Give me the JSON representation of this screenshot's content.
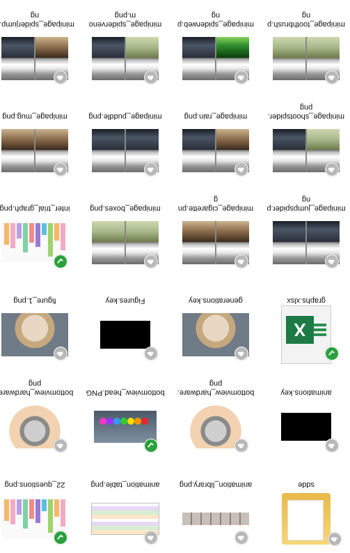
{
  "files": [
    {
      "name": "sdde",
      "type": "folder",
      "badge": "grey"
    },
    {
      "name": "animation_library.png",
      "type": "strip",
      "badge": "grey"
    },
    {
      "name": "animation_table.png",
      "type": "table",
      "badge": "grey"
    },
    {
      "name": "22_questions.png",
      "type": "bars",
      "badge": "green"
    },
    {
      "name": "animations.key",
      "type": "black",
      "badge": "grey"
    },
    {
      "name": "bottomview_hardware.png",
      "type": "hand",
      "badge": "grey"
    },
    {
      "name": "bottomview_head.PNG",
      "type": "blob",
      "badge": "green"
    },
    {
      "name": "bottomview_hardware.png",
      "type": "hand",
      "badge": "grey"
    },
    {
      "name": "graphs.xlsx",
      "type": "xlsx",
      "badge": "green"
    },
    {
      "name": "generations.key",
      "type": "dome",
      "badge": "grey"
    },
    {
      "name": "Figures.key",
      "type": "black",
      "badge": "grey"
    },
    {
      "name": "figure_1.png",
      "type": "dome",
      "badge": "grey"
    },
    {
      "name": "minipage_jumpspider.png",
      "type": "grid",
      "badge": "grey"
    },
    {
      "name": "minipage_cigarette.png",
      "type": "grid",
      "badge": "grey"
    },
    {
      "name": "minipage_boxes.png",
      "type": "grid",
      "badge": "grey"
    },
    {
      "name": "inter_trial_graph.png",
      "type": "bars",
      "badge": "green"
    },
    {
      "name": "minipage_shootspider.png",
      "type": "grid",
      "badge": "grey"
    },
    {
      "name": "minipage_rain.png",
      "type": "grid",
      "badge": "grey"
    },
    {
      "name": "minipage_puddle.png",
      "type": "grid",
      "badge": "grey"
    },
    {
      "name": "minipage_mug.png",
      "type": "grid",
      "badge": "grey"
    },
    {
      "name": "minipage_toothbrush.png",
      "type": "grid",
      "badge": "grey"
    },
    {
      "name": "minipage_spiderweb.png",
      "type": "grid",
      "badge": "grey"
    },
    {
      "name": "minipage_spidervenom.png",
      "type": "grid",
      "badge": "grey"
    },
    {
      "name": "minipage_spiderjump.png",
      "type": "grid",
      "badge": "grey"
    }
  ],
  "colors": {
    "green_badge": "#2aa13c",
    "grey_badge": "#b8b8b8",
    "excel": "#1e7a45"
  }
}
